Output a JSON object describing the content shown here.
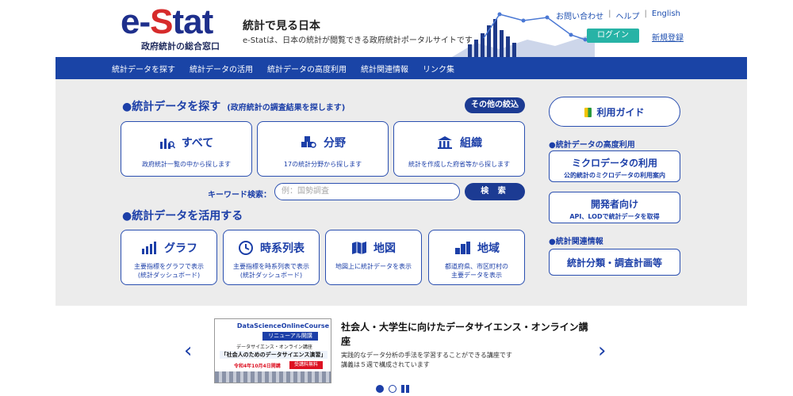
{
  "header": {
    "logo_prefix": "e-",
    "logo_red": "S",
    "logo_suffix": "tat",
    "logo_sub": "政府統計の総合窓口",
    "tagline_title": "統計で見る日本",
    "tagline_sub": "e-Statは、日本の統計が閲覧できる政府統計ポータルサイトです",
    "links": [
      "お問い合わせ",
      "ヘルプ",
      "English"
    ],
    "login": "ログイン",
    "register": "新規登録"
  },
  "nav": [
    "統計データを探す",
    "統計データの活用",
    "統計データの高度利用",
    "統計関連情報",
    "リンク集"
  ],
  "search": {
    "title": "●統計データを探す",
    "note": "(政府統計の調査結果を探します)",
    "other_button": "その他の絞込",
    "cards": [
      {
        "label": "すべて",
        "desc": "政府統計一覧の中から探します",
        "icon": "bar-search-icon"
      },
      {
        "label": "分野",
        "desc": "17の統計分野から探します",
        "icon": "cubes-icon"
      },
      {
        "label": "組織",
        "desc": "統計を作成した府省等から探します",
        "icon": "building-icon"
      }
    ],
    "keyword_label": "キーワード検索：",
    "keyword_placeholder": "例：国勢調査",
    "search_button": "検 索"
  },
  "use": {
    "title": "●統計データを活用する",
    "cards": [
      {
        "label": "グラフ",
        "desc1": "主要指標をグラフで表示",
        "desc2": "(統計ダッシュボード)",
        "icon": "graph-icon"
      },
      {
        "label": "時系列表",
        "desc1": "主要指標を時系列表で表示",
        "desc2": "(統計ダッシュボード)",
        "icon": "clock-icon"
      },
      {
        "label": "地図",
        "desc1": "地図上に統計データを表示",
        "desc2": "",
        "icon": "map-icon"
      },
      {
        "label": "地域",
        "desc1": "都道府県、市区町村の",
        "desc2": "主要データを表示",
        "icon": "region-icon"
      }
    ]
  },
  "side": {
    "guide": "利用ガイド",
    "advanced_head": "●統計データの高度利用",
    "micro_title": "ミクロデータの利用",
    "micro_sub": "公的統計のミクロデータの利用案内",
    "dev_title": "開発者向け",
    "dev_sub": "API、LODで統計データを取得",
    "related_head": "●統計関連情報",
    "classification": "統計分類・調査計画等"
  },
  "banner": {
    "img_line1": "DataScienceOnlineCourse",
    "img_line2": "リニューアル開講",
    "img_line3": "データサイエンス・オンライン講座",
    "img_line4": "「社会人のためのデータサイエンス演習」",
    "img_line5": "令和4年10月4日開講",
    "img_line6": "受講料無料",
    "title": "社会人・大学生に向けたデータサイエンス・オンライン講座",
    "desc1": "実践的なデータ分析の手法を学習することができる講座です",
    "desc2": "講義は５週で構成されています"
  }
}
